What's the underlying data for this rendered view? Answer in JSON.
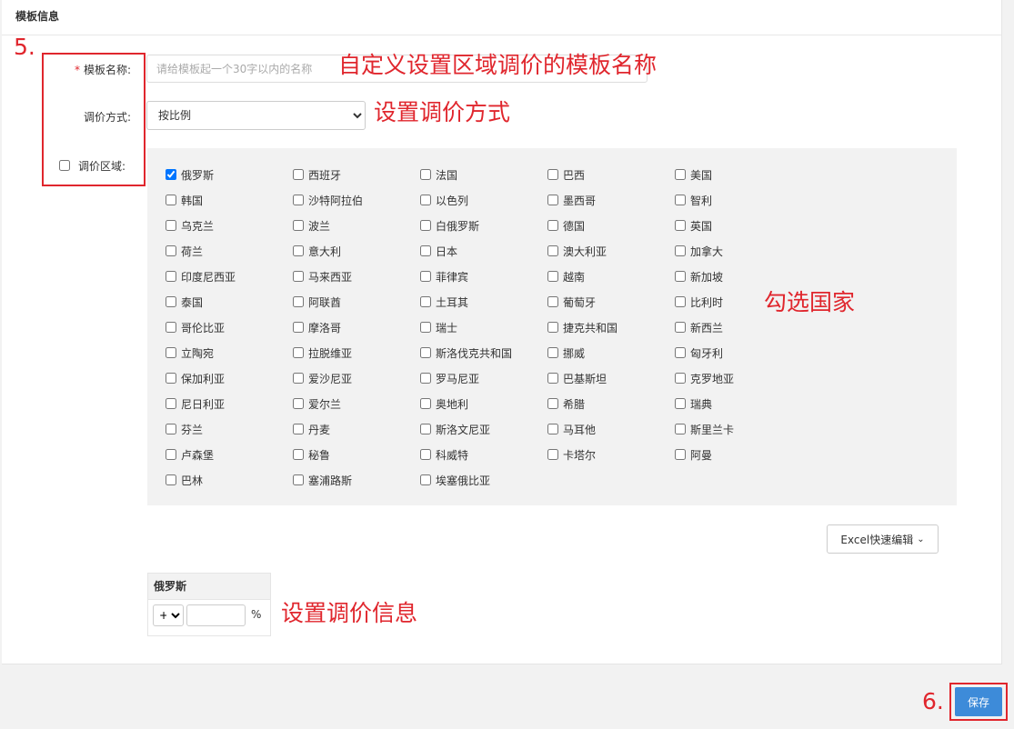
{
  "card": {
    "title": "模板信息"
  },
  "form": {
    "required_mark": "*",
    "name_label": "模板名称:",
    "name_placeholder": "请给模板起一个30字以内的名称",
    "name_value": "",
    "method_label": "调价方式:",
    "method_selected": "按比例",
    "region_label": "调价区域:"
  },
  "countries": [
    {
      "name": "俄罗斯",
      "checked": true
    },
    {
      "name": "西班牙",
      "checked": false
    },
    {
      "name": "法国",
      "checked": false
    },
    {
      "name": "巴西",
      "checked": false
    },
    {
      "name": "美国",
      "checked": false
    },
    {
      "name": "韩国",
      "checked": false
    },
    {
      "name": "沙特阿拉伯",
      "checked": false
    },
    {
      "name": "以色列",
      "checked": false
    },
    {
      "name": "墨西哥",
      "checked": false
    },
    {
      "name": "智利",
      "checked": false
    },
    {
      "name": "乌克兰",
      "checked": false
    },
    {
      "name": "波兰",
      "checked": false
    },
    {
      "name": "白俄罗斯",
      "checked": false
    },
    {
      "name": "德国",
      "checked": false
    },
    {
      "name": "英国",
      "checked": false
    },
    {
      "name": "荷兰",
      "checked": false
    },
    {
      "name": "意大利",
      "checked": false
    },
    {
      "name": "日本",
      "checked": false
    },
    {
      "name": "澳大利亚",
      "checked": false
    },
    {
      "name": "加拿大",
      "checked": false
    },
    {
      "name": "印度尼西亚",
      "checked": false
    },
    {
      "name": "马来西亚",
      "checked": false
    },
    {
      "name": "菲律宾",
      "checked": false
    },
    {
      "name": "越南",
      "checked": false
    },
    {
      "name": "新加坡",
      "checked": false
    },
    {
      "name": "泰国",
      "checked": false
    },
    {
      "name": "阿联酋",
      "checked": false
    },
    {
      "name": "土耳其",
      "checked": false
    },
    {
      "name": "葡萄牙",
      "checked": false
    },
    {
      "name": "比利时",
      "checked": false
    },
    {
      "name": "哥伦比亚",
      "checked": false
    },
    {
      "name": "摩洛哥",
      "checked": false
    },
    {
      "name": "瑞士",
      "checked": false
    },
    {
      "name": "捷克共和国",
      "checked": false
    },
    {
      "name": "新西兰",
      "checked": false
    },
    {
      "name": "立陶宛",
      "checked": false
    },
    {
      "name": "拉脱维亚",
      "checked": false
    },
    {
      "name": "斯洛伐克共和国",
      "checked": false
    },
    {
      "name": "挪威",
      "checked": false
    },
    {
      "name": "匈牙利",
      "checked": false
    },
    {
      "name": "保加利亚",
      "checked": false
    },
    {
      "name": "爱沙尼亚",
      "checked": false
    },
    {
      "name": "罗马尼亚",
      "checked": false
    },
    {
      "name": "巴基斯坦",
      "checked": false
    },
    {
      "name": "克罗地亚",
      "checked": false
    },
    {
      "name": "尼日利亚",
      "checked": false
    },
    {
      "name": "爱尔兰",
      "checked": false
    },
    {
      "name": "奥地利",
      "checked": false
    },
    {
      "name": "希腊",
      "checked": false
    },
    {
      "name": "瑞典",
      "checked": false
    },
    {
      "name": "芬兰",
      "checked": false
    },
    {
      "name": "丹麦",
      "checked": false
    },
    {
      "name": "斯洛文尼亚",
      "checked": false
    },
    {
      "name": "马耳他",
      "checked": false
    },
    {
      "name": "斯里兰卡",
      "checked": false
    },
    {
      "name": "卢森堡",
      "checked": false
    },
    {
      "name": "秘鲁",
      "checked": false
    },
    {
      "name": "科威特",
      "checked": false
    },
    {
      "name": "卡塔尔",
      "checked": false
    },
    {
      "name": "阿曼",
      "checked": false
    },
    {
      "name": "巴林",
      "checked": false
    },
    {
      "name": "塞浦路斯",
      "checked": false
    },
    {
      "name": "埃塞俄比亚",
      "checked": false
    }
  ],
  "excel_button": {
    "label": "Excel快速编辑",
    "chevron": "⌄"
  },
  "price_table": {
    "header": "俄罗斯",
    "operator": "+",
    "value": "",
    "unit": "%"
  },
  "save_button": {
    "label": "保存"
  },
  "annotations": {
    "step5": "5.",
    "name_note": "自定义设置区域调价的模板名称",
    "method_note": "设置调价方式",
    "country_note": "勾选国家",
    "price_note": "设置调价信息",
    "step6": "6."
  },
  "colors": {
    "annotation": "#e0262d",
    "primary": "#3d8bd9",
    "panel_bg": "#f2f2f2"
  }
}
